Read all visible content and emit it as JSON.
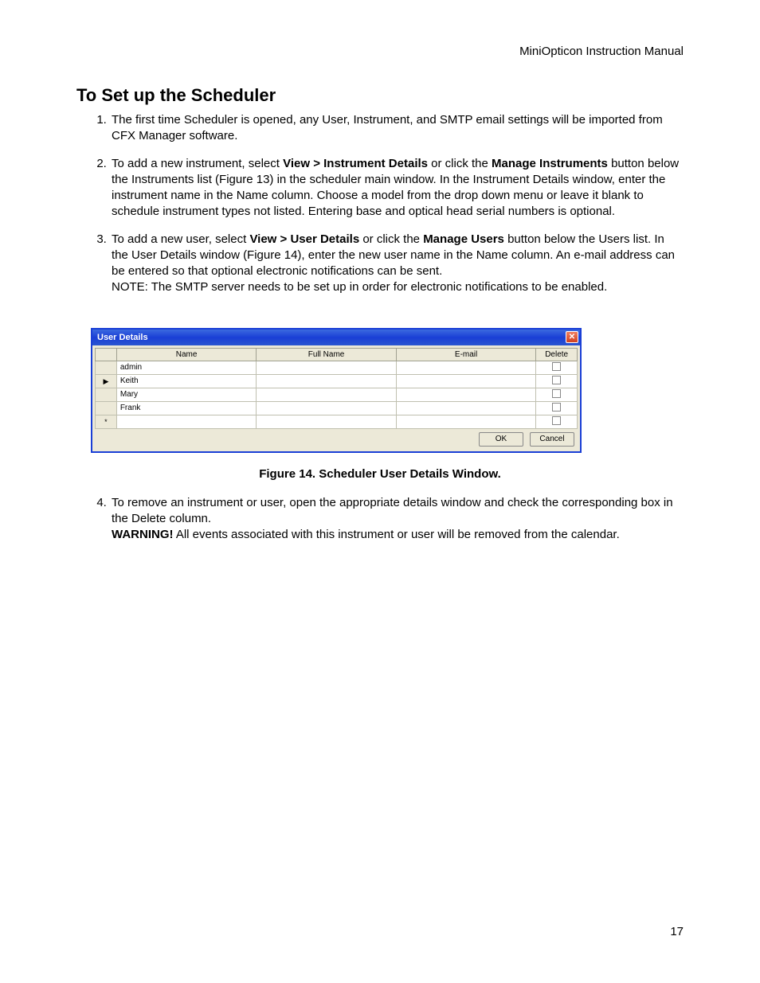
{
  "header": {
    "title": "MiniOpticon Instruction Manual"
  },
  "section": {
    "title": "To Set up the Scheduler"
  },
  "steps": {
    "s1": "The first time Scheduler is opened, any User, Instrument, and SMTP email settings will be imported from CFX Manager software.",
    "s2_a": "To add a new instrument, select ",
    "s2_b1": "View > Instrument Details",
    "s2_c": " or click the ",
    "s2_b2": "Manage Instruments",
    "s2_d": " button below the Instruments list (Figure 13) in the scheduler main window. In the Instrument Details window, enter the instrument name in the Name column. Choose a model from the drop down menu or leave it blank to schedule instrument types not listed. Entering base and optical head serial numbers is optional.",
    "s3_a": "To add a new user, select ",
    "s3_b1": "View > User Details",
    "s3_c": " or click the ",
    "s3_b2": "Manage Users",
    "s3_d": " button below the Users list. In the User Details window (Figure 14), enter the new user name in the Name column. An e-mail address can be entered so that optional electronic notifications can be sent.",
    "s3_note": "NOTE: The SMTP server needs to be set up in order for electronic notifications to be enabled.",
    "s4_a": "To remove an instrument or user, open the appropriate details window and check the corresponding box in the Delete column.",
    "s4_warn_label": "WARNING!",
    "s4_warn_text": " All events associated with this instrument or user will be removed from the calendar."
  },
  "dialog": {
    "title": "User Details",
    "columns": {
      "c0": "",
      "c1": "Name",
      "c2": "Full Name",
      "c3": "E-mail",
      "c4": "Delete"
    },
    "rows": [
      {
        "marker": "",
        "name": "admin",
        "full": "",
        "email": ""
      },
      {
        "marker": "▶",
        "name": "Keith",
        "full": "",
        "email": ""
      },
      {
        "marker": "",
        "name": "Mary",
        "full": "",
        "email": ""
      },
      {
        "marker": "",
        "name": "Frank",
        "full": "",
        "email": ""
      },
      {
        "marker": "*",
        "name": "",
        "full": "",
        "email": ""
      }
    ],
    "buttons": {
      "ok": "OK",
      "cancel": "Cancel"
    }
  },
  "figure_caption": "Figure 14. Scheduler User Details Window.",
  "page_number": "17"
}
